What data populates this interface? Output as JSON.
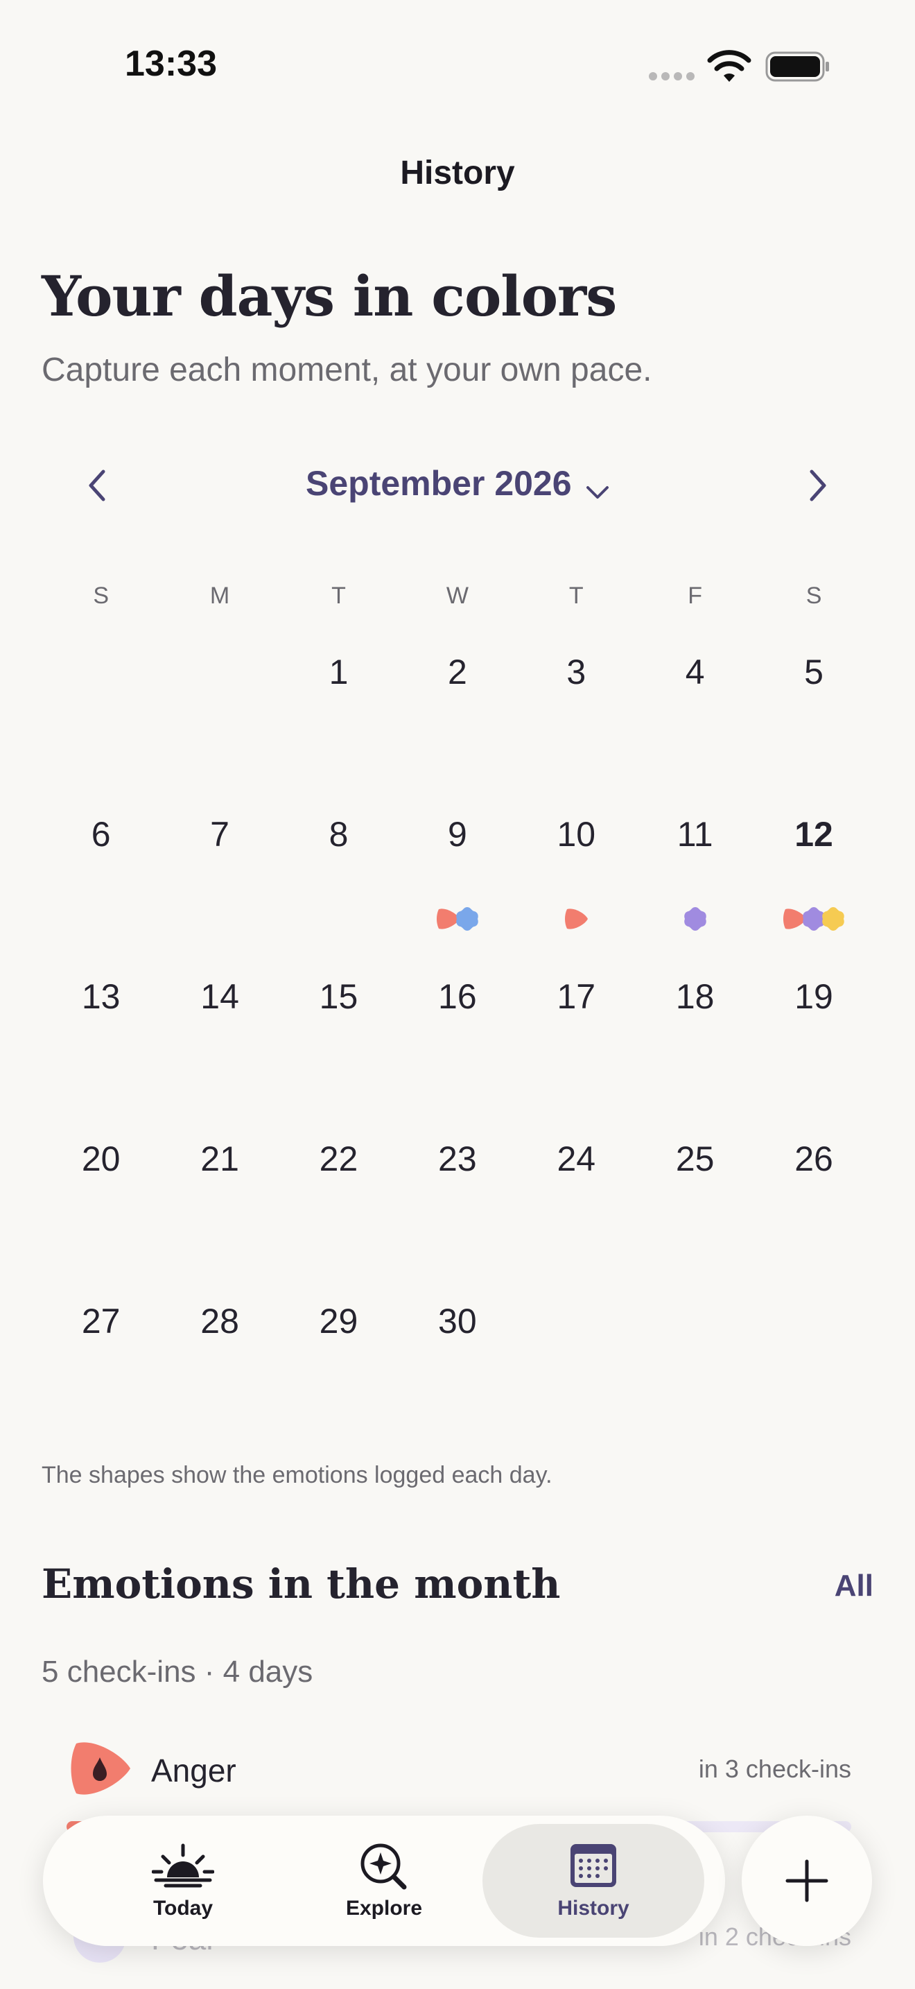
{
  "status_bar": {
    "time": "13:33"
  },
  "nav": {
    "title": "History"
  },
  "hero": {
    "title": "Your days in colors",
    "subtitle": "Capture each moment, at your own pace."
  },
  "calendar": {
    "month_label": "September 2026",
    "weekdays": [
      "S",
      "M",
      "T",
      "W",
      "T",
      "F",
      "S"
    ],
    "weeks": [
      [
        "",
        "",
        "1",
        "2",
        "3",
        "4",
        "5"
      ],
      [
        "6",
        "7",
        "8",
        "9",
        "10",
        "11",
        "12"
      ],
      [
        "13",
        "14",
        "15",
        "16",
        "17",
        "18",
        "19"
      ],
      [
        "20",
        "21",
        "22",
        "23",
        "24",
        "25",
        "26"
      ],
      [
        "27",
        "28",
        "29",
        "30",
        "",
        "",
        ""
      ]
    ],
    "today": "12",
    "day_emotions": {
      "9": [
        "anger",
        "sadness"
      ],
      "10": [
        "anger"
      ],
      "11": [
        "fear"
      ],
      "12": [
        "anger",
        "fear",
        "joy"
      ]
    },
    "caption": "The shapes show the emotions logged each day."
  },
  "emotion_colors": {
    "anger": "#f27d6e",
    "sadness": "#7aa7ea",
    "fear": "#a08be0",
    "joy": "#f6cb52"
  },
  "emotions_section": {
    "title": "Emotions in the month",
    "all_label": "All",
    "summary": "5 check-ins · 4 days",
    "items": [
      {
        "key": "anger",
        "name": "Anger",
        "count_label": "in 3 check-ins",
        "share": 0.6
      },
      {
        "key": "fear",
        "name": "Fear",
        "count_label": "in 2 check-ins",
        "share": 0.4
      }
    ]
  },
  "tabs": [
    {
      "label": "Today",
      "icon": "sunrise-icon",
      "active": false
    },
    {
      "label": "Explore",
      "icon": "sparkle-search-icon",
      "active": false
    },
    {
      "label": "History",
      "icon": "calendar-icon",
      "active": true
    }
  ],
  "add_button": {
    "icon": "plus-icon"
  }
}
